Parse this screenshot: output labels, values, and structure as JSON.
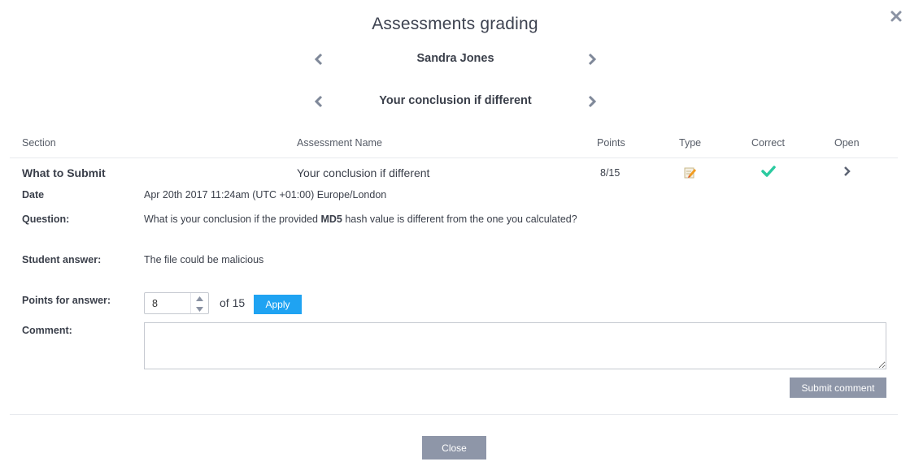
{
  "dialog": {
    "title": "Assessments grading",
    "close_icon": "close-x-icon"
  },
  "student_nav": {
    "name": "Sandra Jones"
  },
  "assessment_nav": {
    "name": "Your conclusion if different"
  },
  "table": {
    "headers": [
      "Section",
      "Assessment Name",
      "Points",
      "Type",
      "Correct",
      "Open"
    ],
    "row": {
      "section": "What to Submit",
      "assessment_name": "Your conclusion if different",
      "points": "8/15",
      "type_icon": "edit-pencil-icon",
      "correct_icon": "checkmark-icon",
      "open_icon": "chevron-right-icon"
    }
  },
  "details": {
    "date_label": "Date",
    "date_value": "Apr 20th 2017 11:24am (UTC +01:00) Europe/London",
    "question_label": "Question:",
    "question_before": "What is your conclusion if the provided ",
    "question_bold": "MD5",
    "question_after": " hash value is different from the one you calculated?",
    "answer_label": "Student answer:",
    "answer_value": "The file could be malicious",
    "points_label": "Points for answer:",
    "points_value": "8",
    "points_of": "of 15",
    "apply_label": "Apply",
    "comment_label": "Comment:",
    "comment_value": "",
    "submit_label": "Submit comment"
  },
  "footer": {
    "close_label": "Close"
  },
  "colors": {
    "accent_blue": "#1fa3f2",
    "button_gray": "#8e96a8",
    "check_green": "#2bcaa0",
    "arrow_gray": "#7f8899"
  }
}
